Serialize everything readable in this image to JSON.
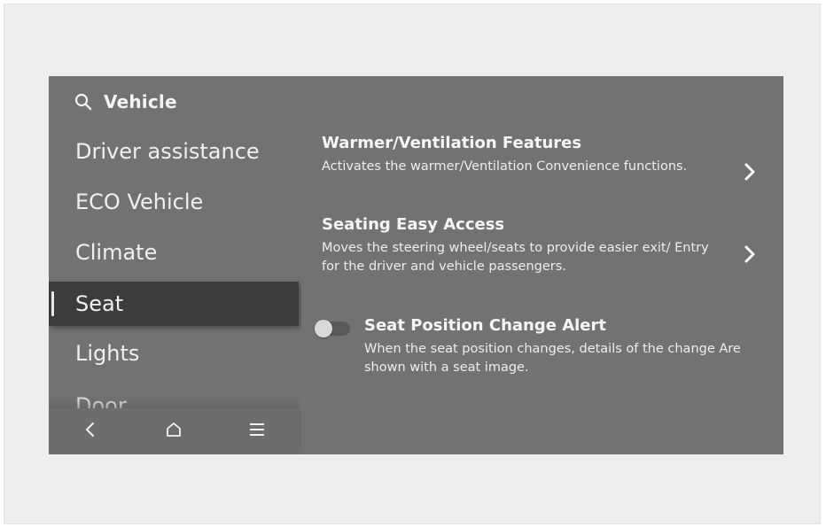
{
  "header": {
    "icon": "search-icon",
    "title": "Vehicle"
  },
  "sidebar": {
    "items": [
      {
        "label": "Driver assistance",
        "selected": false
      },
      {
        "label": "ECO Vehicle",
        "selected": false
      },
      {
        "label": "Climate",
        "selected": false
      },
      {
        "label": "Seat",
        "selected": true
      },
      {
        "label": "Lights",
        "selected": false
      },
      {
        "label": "Door",
        "selected": false
      }
    ]
  },
  "bottom_nav": {
    "items": [
      {
        "icon": "back-icon"
      },
      {
        "icon": "home-icon"
      },
      {
        "icon": "menu-icon"
      }
    ]
  },
  "settings": [
    {
      "title": "Warmer/Ventilation Features",
      "description": "Activates the warmer/Ventilation Convenience functions.",
      "control": "chevron-right-icon"
    },
    {
      "title": "Seating Easy Access",
      "description": "Moves the steering wheel/seats to provide easier exit/ Entry for the driver and vehicle passengers.",
      "control": "chevron-right-icon"
    },
    {
      "title": "Seat Position Change Alert",
      "description": "When the seat position changes, details of the change Are shown with a seat image.",
      "control": "toggle",
      "toggle_on": false
    }
  ],
  "colors": {
    "screen_bg": "#727272",
    "selected_bg": "#3c3c3c",
    "text": "#ffffff"
  }
}
